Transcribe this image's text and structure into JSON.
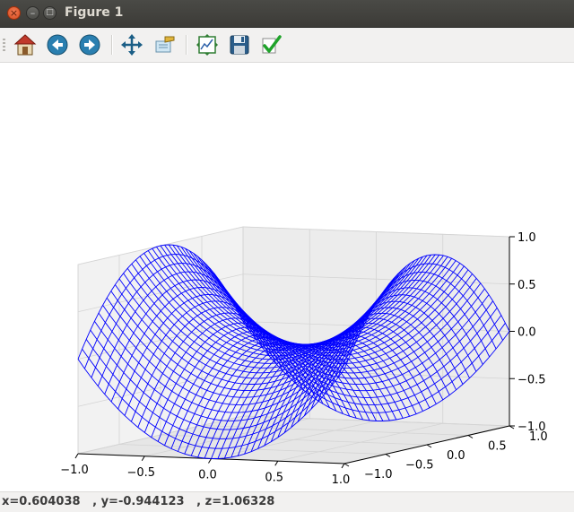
{
  "window": {
    "title": "Figure 1",
    "close_glyph": "×",
    "min_glyph": "–",
    "max_glyph": "□"
  },
  "toolbar": {
    "buttons": [
      {
        "name": "home",
        "icon": "home-icon"
      },
      {
        "name": "back",
        "icon": "arrow-left-icon"
      },
      {
        "name": "forward",
        "icon": "arrow-right-icon"
      },
      {
        "name": "pan",
        "icon": "move-icon"
      },
      {
        "name": "zoom",
        "icon": "zoom-rect-icon"
      },
      {
        "name": "subplots",
        "icon": "subplots-config-icon"
      },
      {
        "name": "save",
        "icon": "floppy-icon"
      },
      {
        "name": "edit",
        "icon": "checkmark-icon"
      }
    ]
  },
  "status": {
    "text": "x=0.604038   , y=-0.944123   , z=1.06328"
  },
  "chart_data": {
    "type": "wireframe",
    "function": "z = x^2 - y^2",
    "x_range": [
      -1.0,
      1.0
    ],
    "y_range": [
      -1.0,
      1.0
    ],
    "z_range": [
      -1.0,
      1.0
    ],
    "x_ticks": [
      "−1.0",
      "−0.5",
      "0.0",
      "0.5",
      "1.0"
    ],
    "y_ticks": [
      "−1.0",
      "−0.5",
      "0.0",
      "0.5",
      "1.0"
    ],
    "z_ticks": [
      "1.0",
      "0.5",
      "0.0",
      "−0.5",
      "−1.0"
    ],
    "grid": true,
    "wire_color": "#0000ff"
  }
}
